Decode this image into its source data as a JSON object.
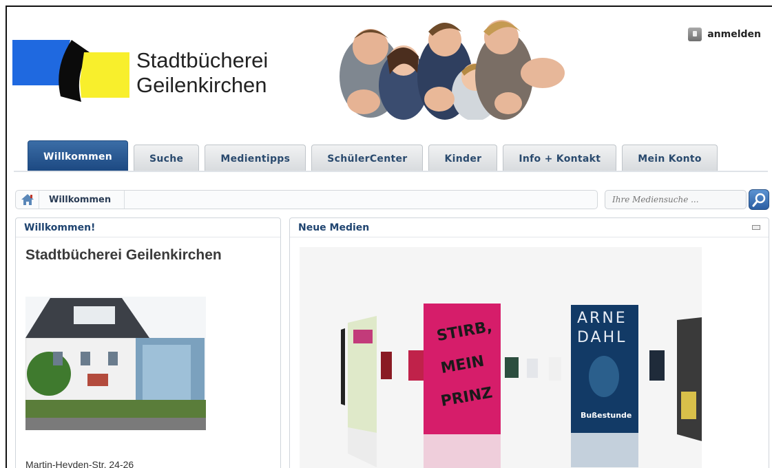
{
  "header": {
    "title_line1": "Stadtbücherei",
    "title_line2": "Geilenkirchen",
    "login_label": "anmelden"
  },
  "nav": {
    "tabs": [
      "Willkommen",
      "Suche",
      "Medientipps",
      "SchülerCenter",
      "Kinder",
      "Info + Kontakt",
      "Mein Konto"
    ],
    "active": "Willkommen"
  },
  "breadcrumb": {
    "current": "Willkommen"
  },
  "search": {
    "placeholder": "Ihre Mediensuche ..."
  },
  "left_panel": {
    "title": "Willkommen!",
    "heading": "Stadtbücherei Geilenkirchen",
    "address": "Martin-Heyden-Str. 24-26"
  },
  "right_panel": {
    "title": "Neue Medien",
    "books": [
      {
        "author": "",
        "title": "STIRB, MEIN PRINZ",
        "color": "#d61d6a"
      },
      {
        "author": "ARNE DAHL",
        "title": "Bußestunde",
        "color": "#123a66"
      }
    ]
  },
  "colors": {
    "accent": "#1f4470",
    "active_tab": "#2b5a92"
  }
}
